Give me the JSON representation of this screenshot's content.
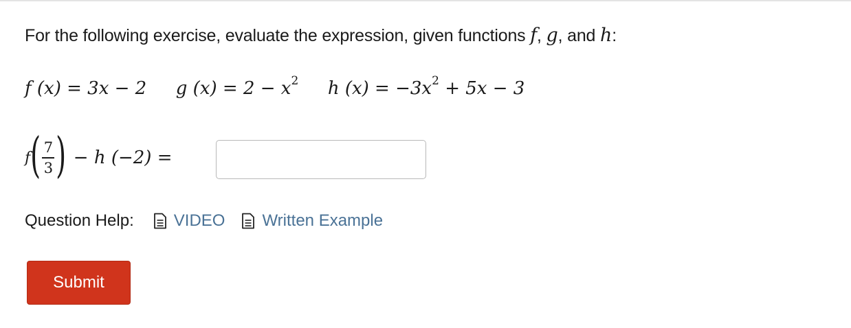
{
  "prompt": {
    "text": "For the following exercise, evaluate the expression, given functions",
    "f": "f",
    "comma1": ",",
    "g": "g",
    "comma2": ",",
    "and": "and",
    "h": "h",
    "colon": ":"
  },
  "functions": {
    "f_def": {
      "name": "f",
      "lhs_rest": "(x) = 3x − 2"
    },
    "g_def": {
      "name": "g",
      "lhs_rest": "(x) = 2 − x",
      "exp": "2"
    },
    "h_def": {
      "name": "h",
      "part1": "(x) = −3x",
      "exp": "2",
      "part2": " + 5x − 3"
    }
  },
  "expression": {
    "f": "f",
    "numerator": "7",
    "denominator": "3",
    "minus_h": "− h (−2) =",
    "answer_value": ""
  },
  "help": {
    "label": "Question Help:",
    "video_label": "VIDEO",
    "written_label": "Written Example",
    "link_color": "#4a7296"
  },
  "submit": {
    "label": "Submit",
    "color": "#d0341c"
  }
}
